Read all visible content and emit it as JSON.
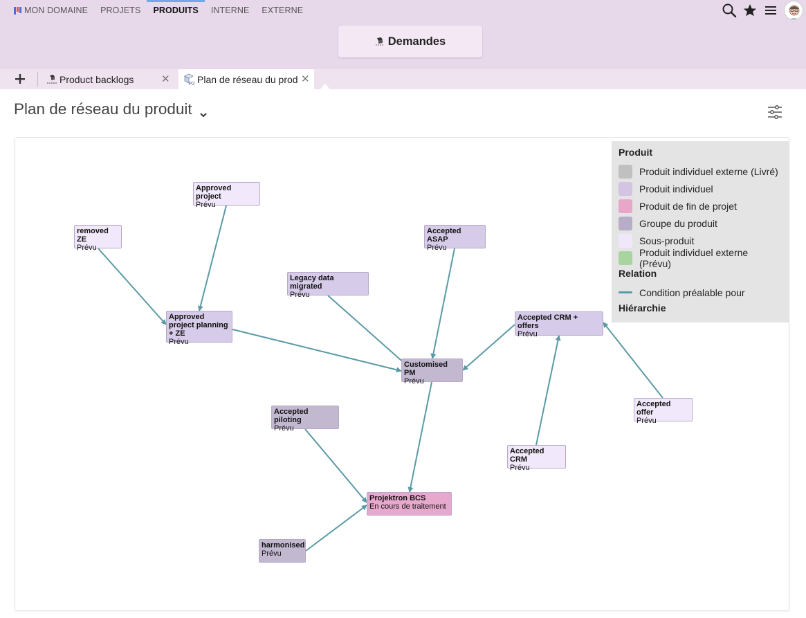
{
  "nav": {
    "items": [
      {
        "label": "MON DOMAINE",
        "active": false
      },
      {
        "label": "PROJETS",
        "active": false
      },
      {
        "label": "PRODUITS",
        "active": true
      },
      {
        "label": "INTERNE",
        "active": false
      },
      {
        "label": "EXTERNE",
        "active": false
      }
    ],
    "icons": [
      "search-icon",
      "star-icon",
      "menu-icon",
      "user-avatar"
    ]
  },
  "demandes": {
    "label": "Demandes"
  },
  "tabs": [
    {
      "label": "Product backlogs",
      "active": false
    },
    {
      "label": "Plan de réseau du produit",
      "active": true
    }
  ],
  "page": {
    "title": "Plan de réseau du produit"
  },
  "graph": {
    "nodes": [
      {
        "id": "approved-project",
        "name": "Approved project",
        "status": "Prévu",
        "type": "sous"
      },
      {
        "id": "removed-ze",
        "name": "removed ZE",
        "status": "Prévu",
        "type": "sous"
      },
      {
        "id": "accepted-asap",
        "name": "Accepted ASAP",
        "status": "Prévu",
        "type": "individuel"
      },
      {
        "id": "legacy-data",
        "name": "Legacy data migrated",
        "status": "Prévu",
        "type": "individuel"
      },
      {
        "id": "approved-planning",
        "name": "Approved project planning + ZE",
        "status": "Prévu",
        "type": "individuel"
      },
      {
        "id": "accepted-crm-offers",
        "name": "Accepted CRM + offers",
        "status": "Prévu",
        "type": "individuel"
      },
      {
        "id": "customised-pm",
        "name": "Customised PM",
        "status": "Prévu",
        "type": "groupe"
      },
      {
        "id": "accepted-offer",
        "name": "Accepted offer",
        "status": "Prévu",
        "type": "sous"
      },
      {
        "id": "accepted-piloting",
        "name": "Accepted piloting",
        "status": "Prévu",
        "type": "groupe"
      },
      {
        "id": "accepted-crm",
        "name": "Accepted CRM",
        "status": "Prévu",
        "type": "sous"
      },
      {
        "id": "projektron-bcs",
        "name": "Projektron BCS",
        "status": "En cours de traitement",
        "type": "fin"
      },
      {
        "id": "harmonised",
        "name": "harmonised",
        "status": "Prévu",
        "type": "groupe"
      }
    ],
    "edges": [
      {
        "from": "approved-project",
        "to": "approved-planning"
      },
      {
        "from": "removed-ze",
        "to": "approved-planning"
      },
      {
        "from": "approved-planning",
        "to": "customised-pm"
      },
      {
        "from": "legacy-data",
        "to": "customised-pm"
      },
      {
        "from": "accepted-asap",
        "to": "customised-pm"
      },
      {
        "from": "accepted-crm-offers",
        "to": "customised-pm"
      },
      {
        "from": "customised-pm",
        "to": "projektron-bcs"
      },
      {
        "from": "accepted-piloting",
        "to": "projektron-bcs"
      },
      {
        "from": "harmonised",
        "to": "projektron-bcs"
      },
      {
        "from": "accepted-crm",
        "to": "accepted-crm-offers"
      },
      {
        "from": "accepted-offer",
        "to": "accepted-crm-offers"
      }
    ],
    "edge_color": "#5a9aa5"
  },
  "legend": {
    "produit_heading": "Produit",
    "items": [
      {
        "label": "Produit individuel externe (Livré)",
        "color": "#c0c0c0"
      },
      {
        "label": "Produit individuel",
        "color": "#d4c4e4"
      },
      {
        "label": "Produit de fin de projet",
        "color": "#e8a6c8"
      },
      {
        "label": "Groupe du produit",
        "color": "#b8adc8"
      },
      {
        "label": "Sous-produit",
        "color": "#f0e8fa"
      },
      {
        "label": "Produit individuel externe (Prévu)",
        "color": "#a8d4a0"
      }
    ],
    "relation_heading": "Relation",
    "relation_label": "Condition préalable pour",
    "hierarchie_heading": "Hiérarchie"
  },
  "colors": {
    "individuel": "#d6cbe8",
    "groupe": "#c2b8d0",
    "sous": "#f1e9fb",
    "fin": "#e6a8cc"
  }
}
